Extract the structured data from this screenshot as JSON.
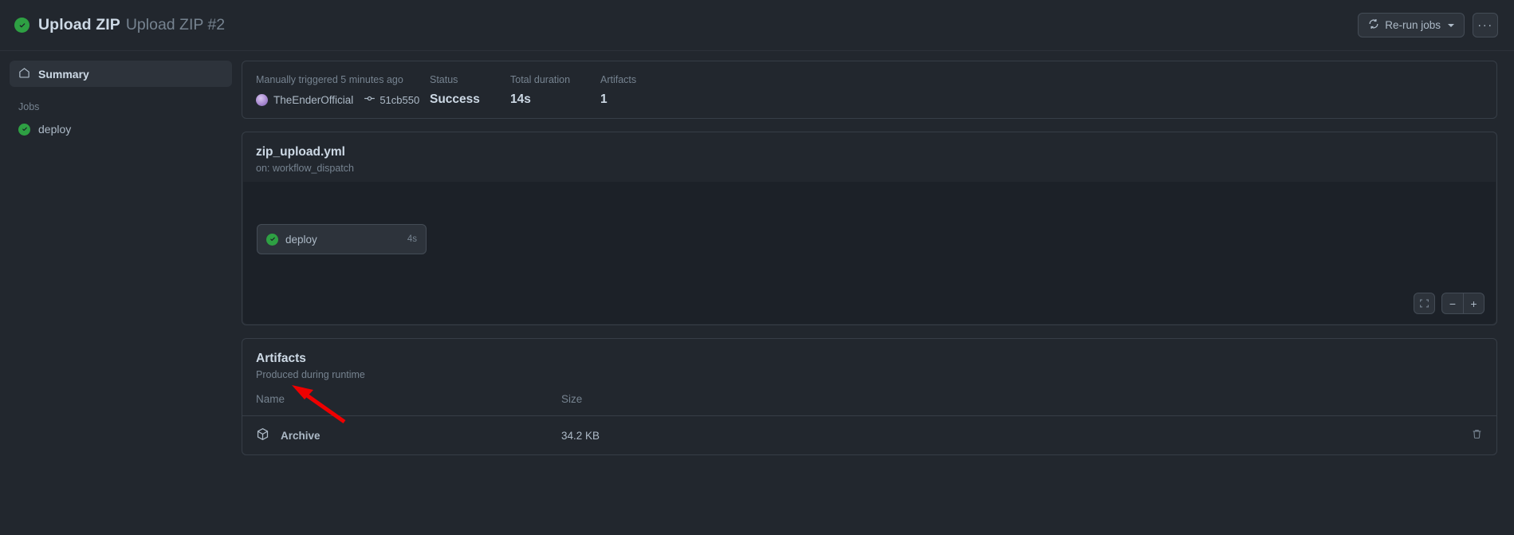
{
  "header": {
    "status_icon": "check-circle-icon",
    "workflow_name": "Upload ZIP",
    "run_title": "Upload ZIP #2",
    "rerun_button": "Re-run jobs",
    "rerun_icon": "sync-icon",
    "more_button": "···"
  },
  "sidebar": {
    "summary_label": "Summary",
    "summary_icon": "home-icon",
    "jobs_heading": "Jobs",
    "jobs": [
      {
        "name": "deploy",
        "status_icon": "check-circle-icon"
      }
    ]
  },
  "summary": {
    "trigger_label": "Manually triggered 5 minutes ago",
    "actor": "TheEnderOfficial",
    "commit_icon": "commit-icon",
    "commit_sha": "51cb550",
    "status_label": "Status",
    "status_value": "Success",
    "duration_label": "Total duration",
    "duration_value": "14s",
    "artifacts_label": "Artifacts",
    "artifacts_value": "1"
  },
  "workflow": {
    "file_name": "zip_upload.yml",
    "trigger": "on: workflow_dispatch",
    "node": {
      "label": "deploy",
      "duration": "4s",
      "status_icon": "check-circle-icon"
    },
    "controls": {
      "fit_icon": "fullscreen-icon",
      "zoom_out": "−",
      "zoom_in": "+"
    }
  },
  "artifacts": {
    "title": "Artifacts",
    "subtitle": "Produced during runtime",
    "columns": {
      "name": "Name",
      "size": "Size"
    },
    "rows": [
      {
        "icon": "package-icon",
        "name": "Archive",
        "size": "34.2 KB",
        "delete_icon": "trash-icon"
      }
    ]
  },
  "annotation": {
    "arrow_color": "#ee0000",
    "target": "Archive"
  },
  "colors": {
    "page_bg": "#22272e",
    "card_border": "#373e47",
    "graph_bg": "#1c2128",
    "success_green": "#2ea043",
    "text_primary": "#cdd9e5",
    "text_muted": "#768390"
  }
}
